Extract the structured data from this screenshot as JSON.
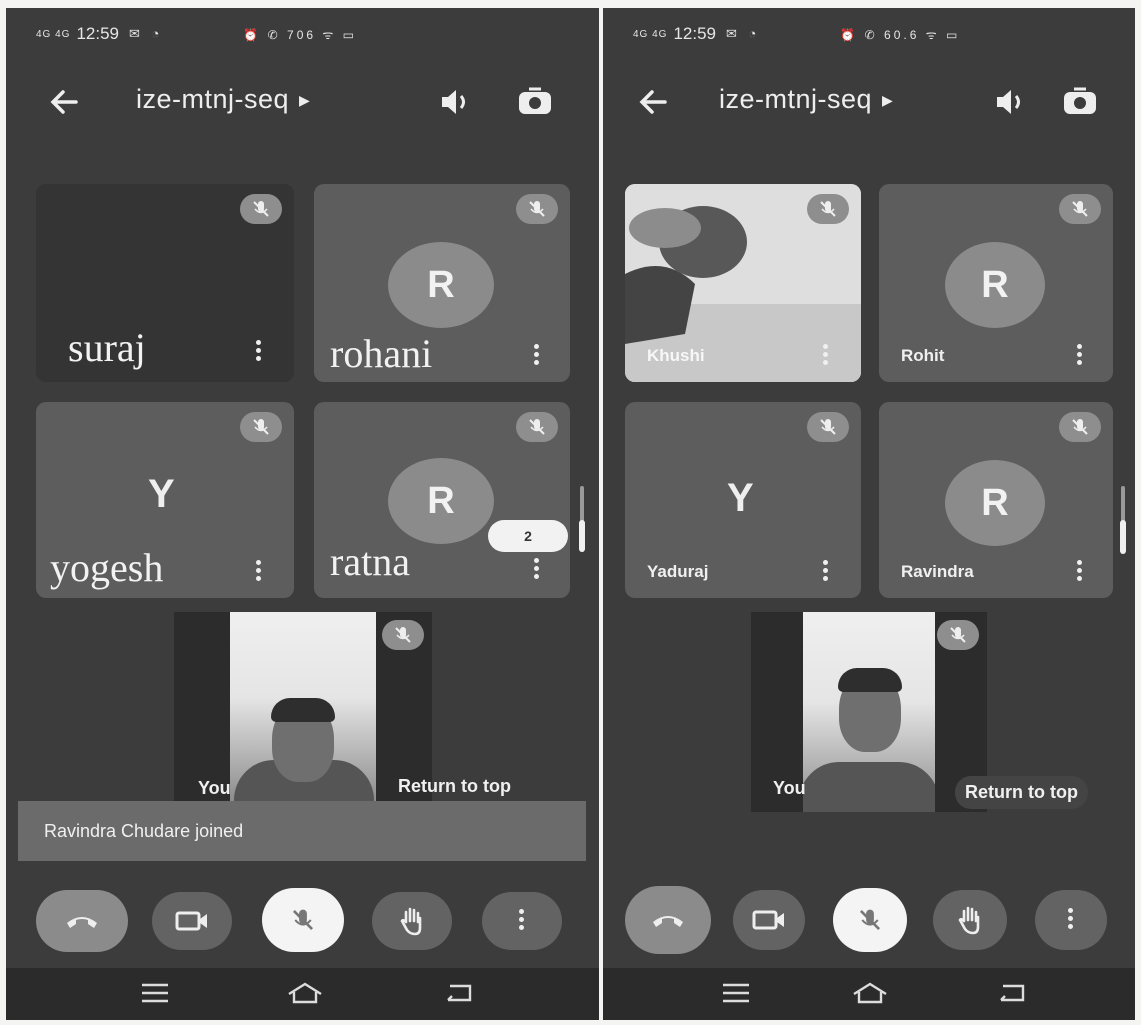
{
  "status": {
    "signal": "4G 4G",
    "time": "12:59",
    "notifications": "✉ ◔",
    "system_left": "⏰ ✆ 706 ᯤ ▭",
    "system_right": "⏰ ✆ 60.6 ᯤ ▭"
  },
  "meeting": {
    "code": "ize-mtnj-seq"
  },
  "left_screen": {
    "participants": [
      {
        "name": "suraj"
      },
      {
        "name": "rohani",
        "initial": "R"
      },
      {
        "name": "yogesh",
        "initial": "Y"
      },
      {
        "name": "ratna",
        "initial": "R"
      }
    ],
    "more_count": "2",
    "self_label": "You",
    "return_label": "Return to top",
    "toast": "Ravindra Chudare joined"
  },
  "right_screen": {
    "participants": [
      {
        "name": "Khushi"
      },
      {
        "name": "Rohit",
        "initial": "R"
      },
      {
        "name": "Yaduraj",
        "initial": "Y"
      },
      {
        "name": "Ravindra",
        "initial": "R"
      }
    ],
    "self_label": "You",
    "return_label": "Return to top"
  },
  "icons": [
    "back-arrow-icon",
    "speaker-icon",
    "switch-camera-icon",
    "mic-off-icon",
    "more-icon",
    "end-call-icon",
    "camera-icon",
    "raise-hand-icon",
    "menu-icon",
    "home-icon",
    "back-icon"
  ]
}
